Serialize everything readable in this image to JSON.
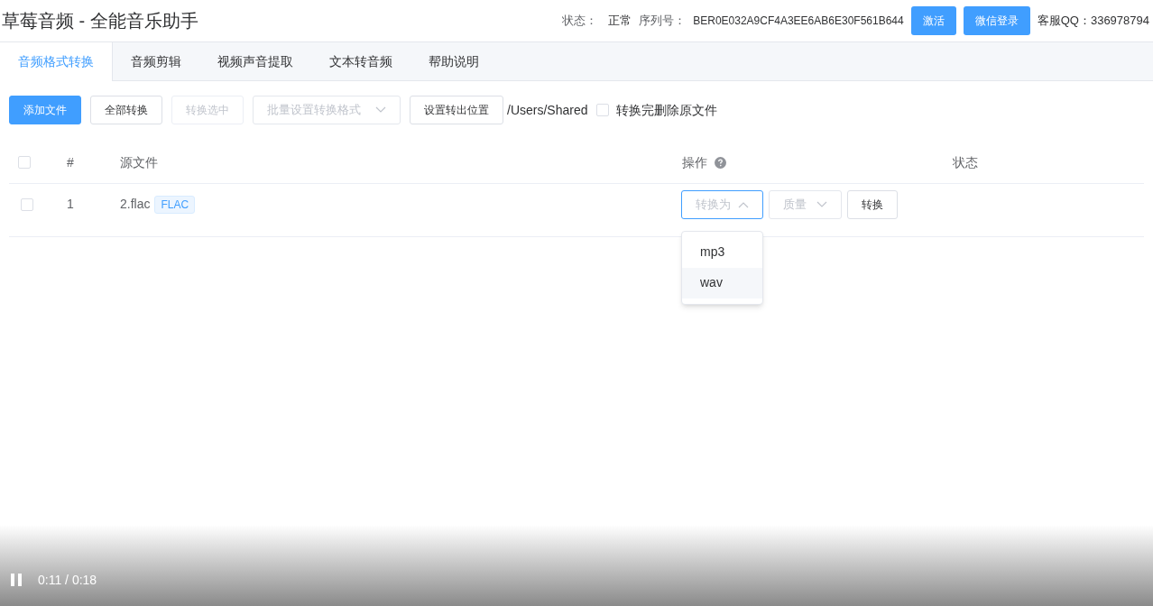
{
  "header": {
    "title": "草莓音频 - 全能音乐助手",
    "status_label": "状态：",
    "status_value": "正常",
    "serial_label": "序列号：",
    "serial_value": "BER0E032A9CF4A3EE6AB6E30F561B644",
    "buttons": [
      "激活",
      "微信登录"
    ],
    "support": "客服QQ：336978794"
  },
  "tabs": [
    {
      "label": "音频格式转换",
      "selected": true
    },
    {
      "label": "音频剪辑",
      "selected": false
    },
    {
      "label": "视频声音提取",
      "selected": false
    },
    {
      "label": "文本转音频",
      "selected": false
    },
    {
      "label": "帮助说明",
      "selected": false
    }
  ],
  "toolbar": {
    "items": [
      {
        "kind": "button",
        "label": "添加文件",
        "primary": true,
        "disabled": false
      },
      {
        "kind": "button",
        "label": "全部转换",
        "primary": false,
        "disabled": false
      },
      {
        "kind": "button",
        "label": "转换选中",
        "primary": false,
        "disabled": true
      },
      {
        "kind": "select",
        "placeholder": "批量设置转换格式",
        "disabled": true
      },
      {
        "kind": "button",
        "label": "设置转出位置",
        "primary": false,
        "disabled": false
      },
      {
        "kind": "path",
        "text": "/Users/Shared"
      },
      {
        "kind": "checkbox",
        "label": "转换完删除原文件",
        "checked": false
      }
    ]
  },
  "table": {
    "select_all_checked": false,
    "columns": [
      "#",
      "源文件",
      "操作",
      "状态"
    ],
    "rows": [
      {
        "checked": false,
        "index": "1",
        "file": "2.flac",
        "tag": "FLAC",
        "format_select": {
          "placeholder": "转换为",
          "expanded": true,
          "options": [
            {
              "label": "mp3",
              "highlighted": false
            },
            {
              "label": "wav",
              "highlighted": true
            }
          ]
        },
        "quality_select": {
          "placeholder": "质量",
          "expanded": false
        },
        "action": "转换"
      }
    ]
  },
  "player": {
    "paused": false,
    "time": "0:11 / 0:18"
  }
}
